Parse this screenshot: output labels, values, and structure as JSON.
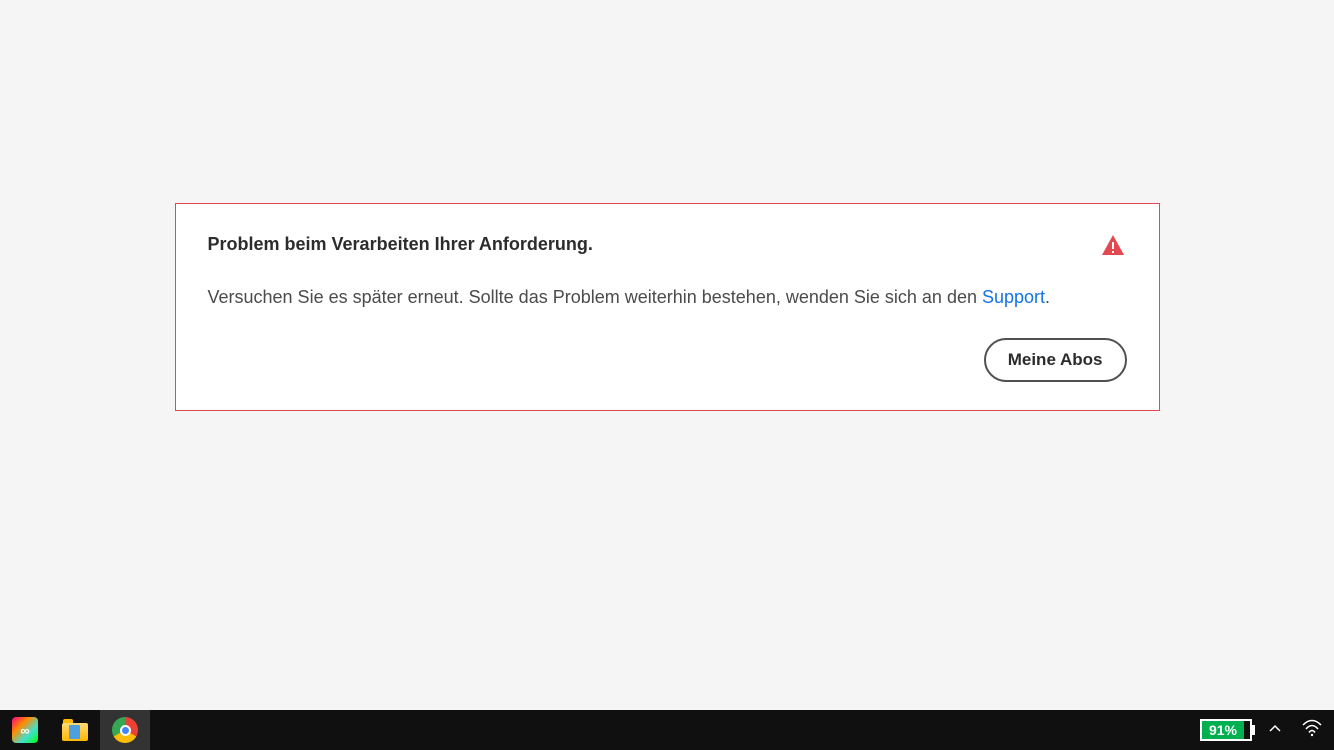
{
  "error": {
    "title": "Problem beim Verarbeiten Ihrer Anforderung.",
    "body_prefix": "Versuchen Sie es später erneut. Sollte das Problem weiterhin bestehen, wenden Sie sich an den ",
    "support_link": "Support",
    "body_suffix": ".",
    "button_label": "Meine Abos"
  },
  "taskbar": {
    "battery_percent": "91%"
  }
}
